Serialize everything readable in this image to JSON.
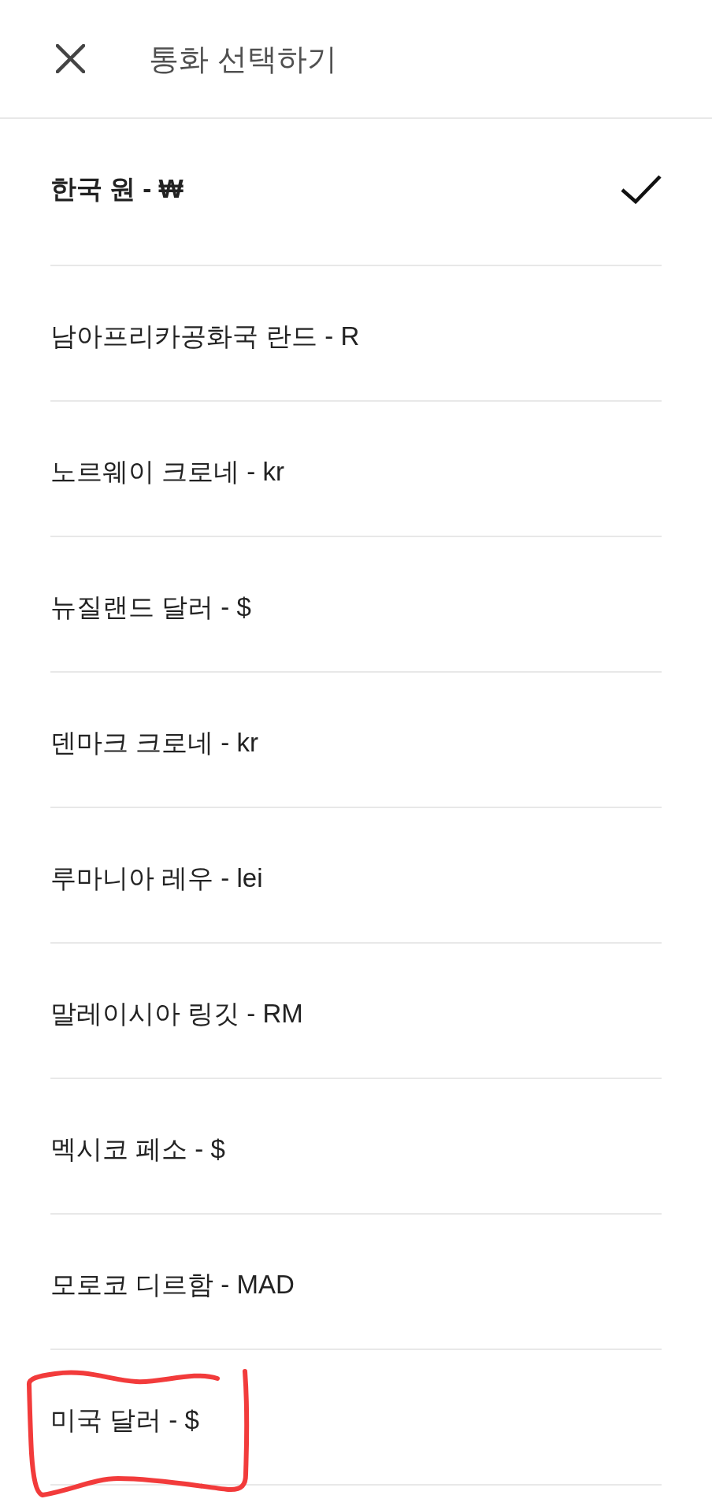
{
  "header": {
    "title": "통화 선택하기"
  },
  "items": [
    {
      "label": "한국 원 - ₩",
      "selected": true,
      "highlighted": false
    },
    {
      "label": "남아프리카공화국 란드 - R",
      "selected": false,
      "highlighted": false
    },
    {
      "label": "노르웨이 크로네 - kr",
      "selected": false,
      "highlighted": false
    },
    {
      "label": "뉴질랜드 달러 - $",
      "selected": false,
      "highlighted": false
    },
    {
      "label": "덴마크 크로네 - kr",
      "selected": false,
      "highlighted": false
    },
    {
      "label": "루마니아 레우 - lei",
      "selected": false,
      "highlighted": false
    },
    {
      "label": "말레이시아 링깃 - RM",
      "selected": false,
      "highlighted": false
    },
    {
      "label": "멕시코 페소 - $",
      "selected": false,
      "highlighted": false
    },
    {
      "label": "모로코 디르함 - MAD",
      "selected": false,
      "highlighted": false
    },
    {
      "label": "미국 달러 - $",
      "selected": false,
      "highlighted": true
    }
  ]
}
